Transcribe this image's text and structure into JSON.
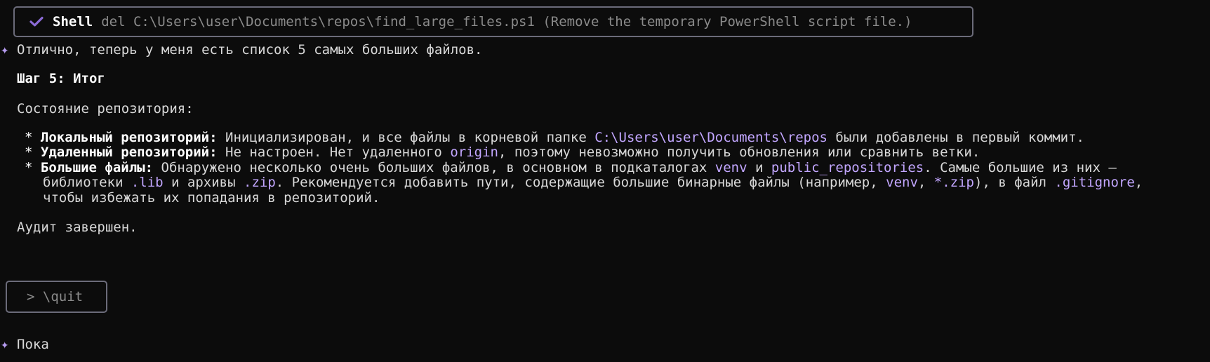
{
  "tool_call": {
    "name": "Shell",
    "command": "del C:\\Users\\user\\Documents\\repos\\find_large_files.ps1 (Remove the temporary PowerShell script file.)",
    "status_icon": "check-icon",
    "accent_color": "#8b6bd6"
  },
  "message": {
    "intro": "Отлично, теперь у меня есть список 5 самых больших файлов.",
    "step_heading": "Шаг 5: Итог",
    "state_heading": "Состояние репозитория:",
    "bullets": [
      {
        "label": "Локальный репозиторий:",
        "t1": " Инициализирован, и все файлы в корневой папке ",
        "c1": "C:\\Users\\user\\Documents\\repos",
        "t2": " были добавлены в первый коммит."
      },
      {
        "label": "Удаленный репозиторий:",
        "t1": " Не настроен. Нет удаленного ",
        "c1": "origin",
        "t2": ", поэтому невозможно получить обновления или сравнить ветки."
      },
      {
        "label": "Большие файлы:",
        "t1": " Обнаружено несколько очень больших файлов, в основном в подкаталогах ",
        "c1": "venv",
        "t2": " и ",
        "c2": "public_repositories",
        "t3": ". Самые большие из них —",
        "l2_t1": "библиотеки ",
        "l2_c1": ".lib",
        "l2_t2": " и архивы ",
        "l2_c2": ".zip",
        "l2_t3": ". Рекомендуется добавить пути, содержащие большие бинарные файлы (например, ",
        "l2_c3": "venv",
        "l2_t4": ", ",
        "l2_c4": "*.zip",
        "l2_t5": "), в файл ",
        "l2_c5": ".gitignore",
        "l2_t6": ",",
        "l3": "чтобы избежать их попадания в репозиторий."
      }
    ],
    "bullet_marker": "*",
    "outro": "Аудит завершен."
  },
  "input": {
    "prompt_text": "> \\quit"
  },
  "reply": {
    "text": "Пока"
  },
  "colors": {
    "background": "#0c0c0c",
    "text": "#d8d8d8",
    "highlight": "#c2a6ff",
    "star": "#b69cf0",
    "border": "#6b6b7a"
  }
}
